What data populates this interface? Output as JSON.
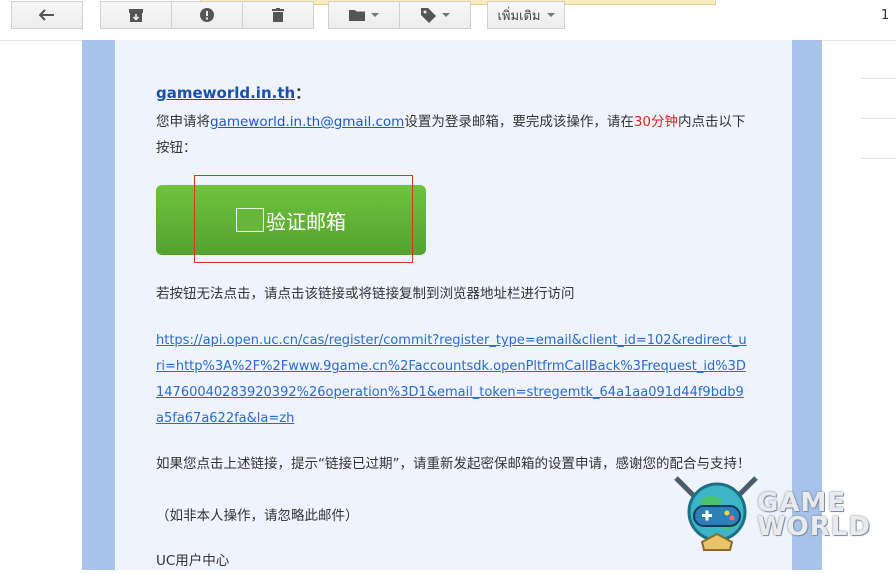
{
  "toolbar": {
    "more_label": "เพิ่มเติม",
    "page_count": "1"
  },
  "email": {
    "brand_link": "gameworld.in.th",
    "brand_colon": "：",
    "line1_pre": "您申请将",
    "line1_email": "gameworld.in.th@gmail.com",
    "line1_mid": "设置为登录邮箱，要完成该操作，请在",
    "line1_time": "30分钟",
    "line1_post": "内点击以下按钮：",
    "verify_button": "验证邮箱",
    "fallback_text": "若按钮无法点击，请点击该链接或将链接复制到浏览器地址栏进行访问",
    "verify_url": "https://api.open.uc.cn/cas/register/commit?register_type=email&client_id=102&redirect_uri=http%3A%2F%2Fwww.9game.cn%2Faccountsdk.openPltfrmCallBack%3Frequest_id%3D14760040283920392%26operation%3D1&email_token=stregemtk_64a1aa091d44f9bdb9a5fa67a622fa&la=zh",
    "expired_text": "如果您点击上述链接，提示“链接已过期”，请重新发起密保邮箱的设置申请，感谢您的配合与支持！",
    "ignore_text": "（如非本人操作，请忽略此邮件）",
    "signature": "UC用户中心"
  },
  "watermark": {
    "line1": "GAME",
    "line2": "WORLD"
  },
  "colors": {
    "frame": "#a7c3e9",
    "card": "#eef3fd",
    "button": "#5cb034",
    "highlight": "#e0221c",
    "link": "#2a6bcf"
  }
}
